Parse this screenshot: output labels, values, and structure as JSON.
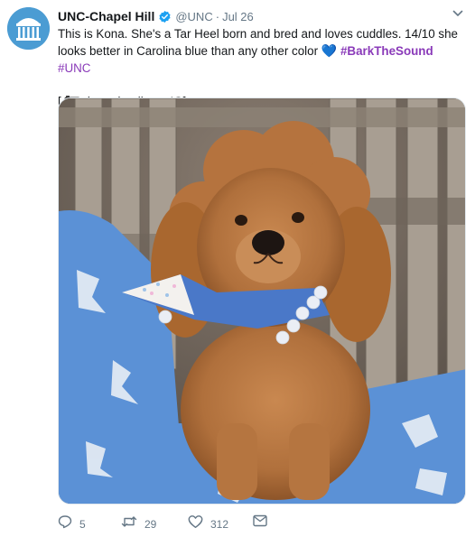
{
  "author": {
    "name": "UNC-Chapel Hill",
    "handle": "@UNC",
    "separator": "·",
    "date": "Jul 26",
    "verified": true
  },
  "tweet": {
    "text_part1": "This is Kona. She's a Tar Heel born and bred and loves cuddles. 14/10 she looks better in Carolina blue than any other color",
    "emoji": "💙",
    "hashtag1": "#BarkTheSound",
    "hashtag2": "#UNC",
    "credit_open": "[",
    "credit_text": ": konadoodle on IG]"
  },
  "actions": {
    "replies": "5",
    "retweets": "29",
    "likes": "312"
  },
  "colors": {
    "carolina_blue": "#4b9cd3",
    "hashtag": "#8a3ab9",
    "meta_gray": "#657786"
  },
  "icons": [
    "unc-well-logo-icon",
    "verified-badge-icon",
    "chevron-down-icon",
    "camera-icon",
    "reply-icon",
    "retweet-icon",
    "like-icon",
    "message-icon"
  ]
}
